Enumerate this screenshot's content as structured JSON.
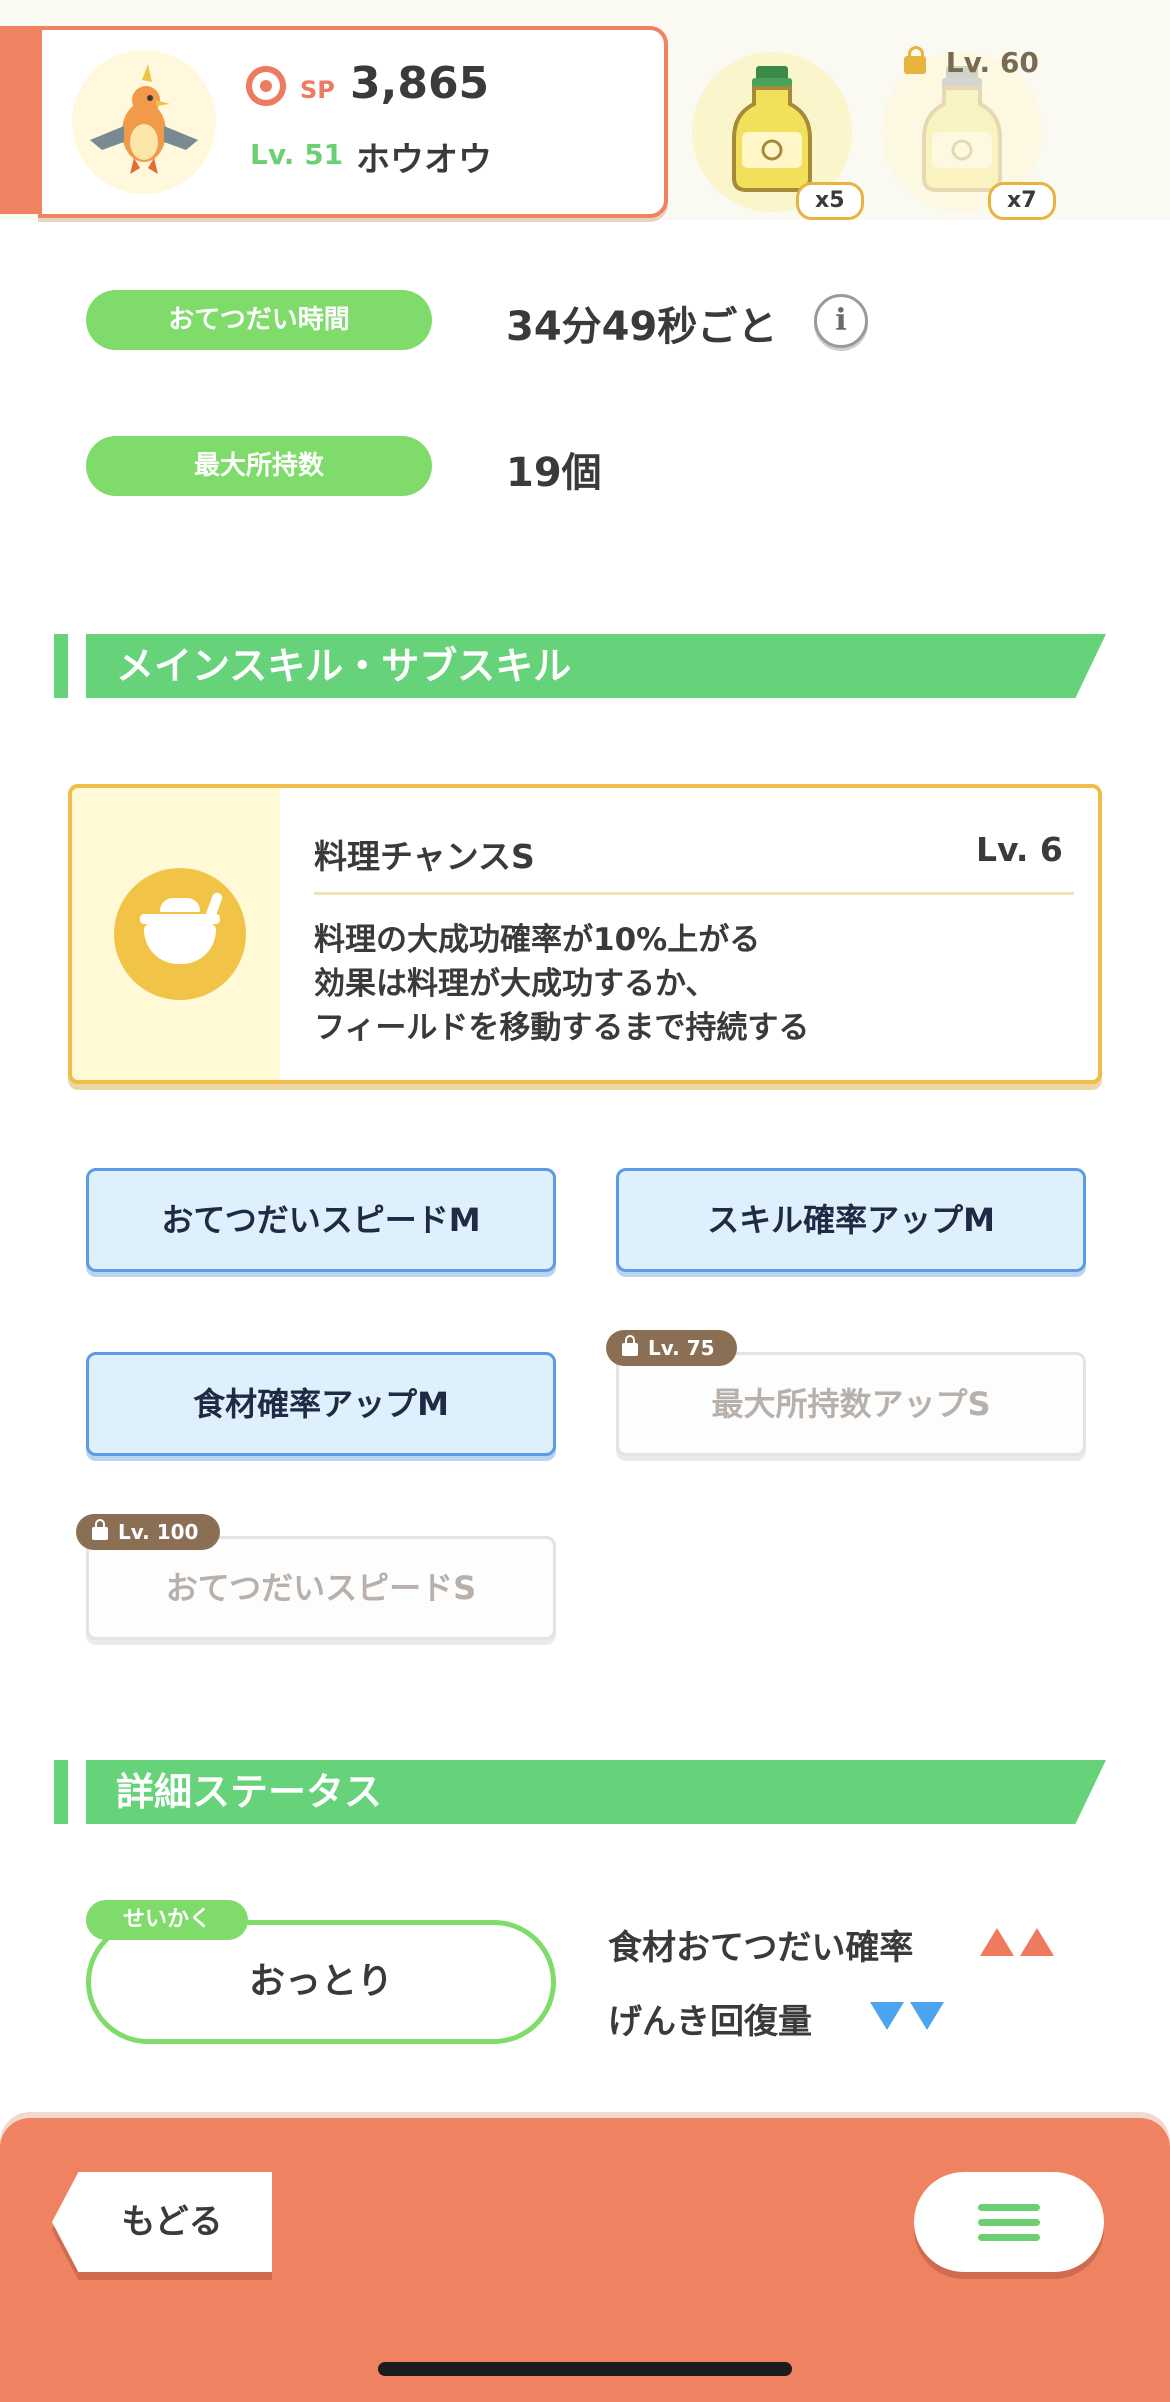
{
  "pokemon": {
    "sp_label": "SP",
    "sp_value": "3,865",
    "level": "Lv. 51",
    "name": "ホウオウ"
  },
  "items": [
    {
      "name": "main-item",
      "count": "x5"
    },
    {
      "name": "locked-item",
      "count": "x7",
      "lock_level": "Lv. 60"
    }
  ],
  "info": {
    "help_time_label": "おてつだい時間",
    "help_time_value": "34分49秒ごと",
    "max_carry_label": "最大所持数",
    "max_carry_value": "19個"
  },
  "skills_section": {
    "title": "メインスキル・サブスキル",
    "main": {
      "name": "料理チャンスS",
      "level": "Lv. 6",
      "description": "料理の大成功確率が10%上がる\n効果は料理が大成功するか、\nフィールドを移動するまで持続する"
    },
    "sub": [
      {
        "label": "おてつだいスピードM",
        "unlocked": true
      },
      {
        "label": "スキル確率アップM",
        "unlocked": true
      },
      {
        "label": "食材確率アップM",
        "unlocked": true
      },
      {
        "label": "最大所持数アップS",
        "unlocked": false,
        "lock_level": "Lv. 75"
      },
      {
        "label": "おてつだいスピードS",
        "unlocked": false,
        "lock_level": "Lv. 100"
      }
    ]
  },
  "status_section": {
    "title": "詳細ステータス",
    "nature_tag": "せいかく",
    "nature": "おっとり",
    "effects": [
      {
        "label": "食材おてつだい確率",
        "direction": "up"
      },
      {
        "label": "げんき回復量",
        "direction": "down"
      }
    ]
  },
  "bottom": {
    "back_label": "もどる"
  },
  "colors": {
    "accent": "#ef8261",
    "green": "#66d27a",
    "gold": "#f0bd4a",
    "blue": "#5c9be6",
    "up": "#ee7a5f",
    "down": "#4ca3ef"
  }
}
